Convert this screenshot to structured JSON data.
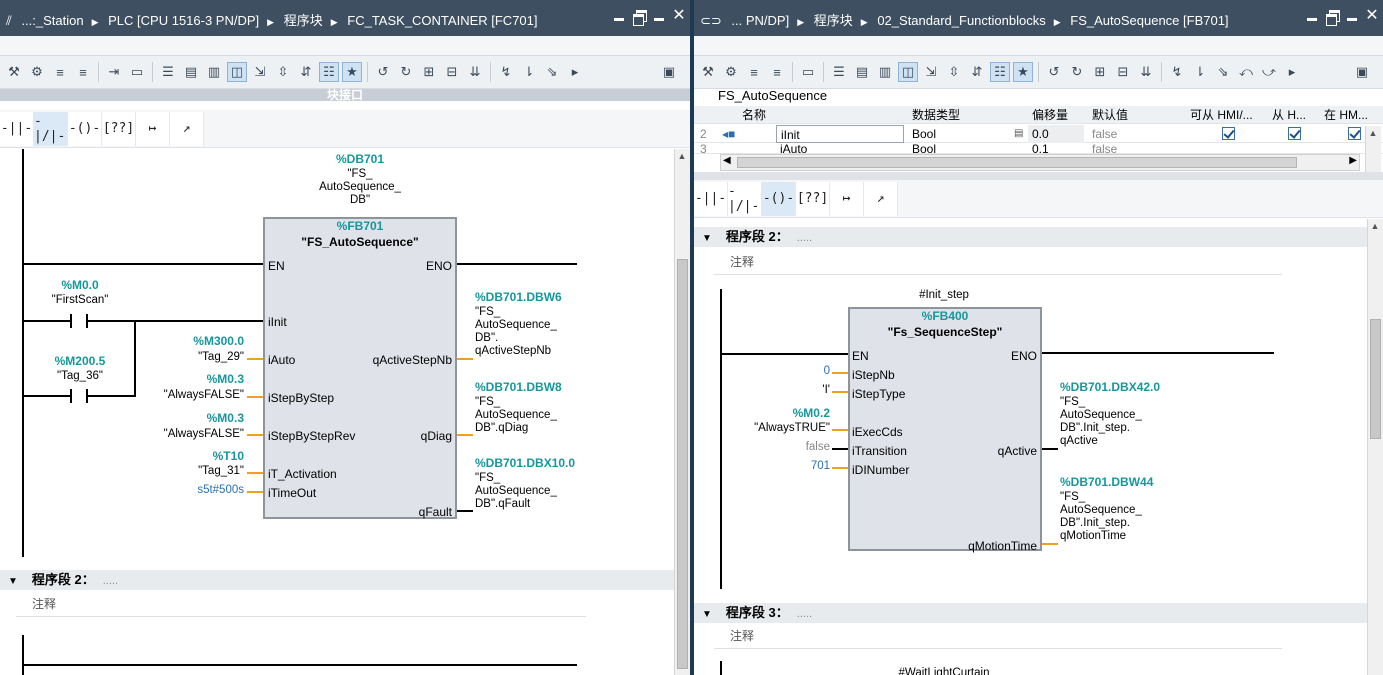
{
  "left": {
    "breadcrumb": [
      "...:_Station",
      "PLC [CPU 1516-3 PN/DP]",
      "程序块",
      "FC_TASK_CONTAINER [FC701]"
    ],
    "block_interface_label": "块接口",
    "ladder_tools": [
      "-||-",
      "-|/|-",
      "-()-",
      "[??]",
      "↦",
      "↗"
    ],
    "network1": {
      "db_addr": "%DB701",
      "db_name_lines": [
        "\"FS_",
        "AutoSequence_",
        "DB\""
      ],
      "fb_addr": "%FB701",
      "fb_name": "\"FS_AutoSequence\"",
      "in_pins": [
        "EN",
        "iInit",
        "iAuto",
        "iStepByStep",
        "iStepByStepRev",
        "iT_Activation",
        "iTimeOut"
      ],
      "out_pins": [
        "ENO",
        "qActiveStepNb",
        "qDiag",
        "qFault"
      ],
      "contact1_addr": "%M0.0",
      "contact1_name": "\"FirstScan\"",
      "contact2_addr": "%M200.5",
      "contact2_name": "\"Tag_36\"",
      "inputs": [
        {
          "addr": "%M300.0",
          "name": "\"Tag_29\""
        },
        {
          "addr": "%M0.3",
          "name": "\"AlwaysFALSE\""
        },
        {
          "addr": "%M0.3",
          "name": "\"AlwaysFALSE\""
        },
        {
          "addr": "%T10",
          "name": "\"Tag_31\""
        },
        {
          "addr": "",
          "name": "s5t#500s"
        }
      ],
      "outputs": [
        {
          "addr": "%DB701.DBW6",
          "lines": [
            "\"FS_",
            "AutoSequence_",
            "DB\".",
            "qActiveStepNb"
          ]
        },
        {
          "addr": "%DB701.DBW8",
          "lines": [
            "\"FS_",
            "AutoSequence_",
            "DB\".qDiag"
          ]
        },
        {
          "addr": "%DB701.DBX10.0",
          "lines": [
            "\"FS_",
            "AutoSequence_",
            "DB\".qFault"
          ]
        }
      ]
    },
    "network2": {
      "title": "程序段 2：",
      "dots": ".....",
      "comment": "注释"
    }
  },
  "right": {
    "breadcrumb": [
      "... PN/DP]",
      "程序块",
      "02_Standard_Functionblocks",
      "FS_AutoSequence [FB701]"
    ],
    "interface_title": "FS_AutoSequence",
    "table_headers": [
      "名称",
      "数据类型",
      "偏移量",
      "默认值",
      "可从 HMI/...",
      "从 H...",
      "在 HM..."
    ],
    "table_rows": [
      {
        "num": "2",
        "name": "iInit",
        "type": "Bool",
        "offset": "0.0",
        "default": "false"
      },
      {
        "num": "3",
        "name": "iAuto",
        "type": "Bool",
        "offset": "0.1",
        "default": "false"
      }
    ],
    "ladder_tools": [
      "-||-",
      "-|/|-",
      "-()-",
      "[??]",
      "↦",
      "↗"
    ],
    "network2": {
      "title": "程序段 2：",
      "dots": ".....",
      "comment": "注释",
      "instance": "#Init_step",
      "fb_addr": "%FB400",
      "fb_name": "\"Fs_SequenceStep\"",
      "in_pins": [
        "EN",
        "iStepNb",
        "iStepType",
        "iExecCds",
        "iTransition",
        "iDINumber"
      ],
      "out_pins": [
        "ENO",
        "qActive",
        "qMotionTime"
      ],
      "in_vals": [
        "0",
        "'I'",
        "",
        "false",
        "701"
      ],
      "exec_addr": "%M0.2",
      "exec_name": "\"AlwaysTRUE\"",
      "outputs": [
        {
          "addr": "%DB701.DBX42.0",
          "lines": [
            "\"FS_",
            "AutoSequence_",
            "DB\".Init_step.",
            "qActive"
          ]
        },
        {
          "addr": "%DB701.DBW44",
          "lines": [
            "\"FS_",
            "AutoSequence_",
            "DB\".Init_step.",
            "qMotionTime"
          ]
        }
      ]
    },
    "network3": {
      "title": "程序段 3：",
      "dots": ".....",
      "comment": "注释",
      "instance": "#WaitLightCurtain"
    }
  }
}
